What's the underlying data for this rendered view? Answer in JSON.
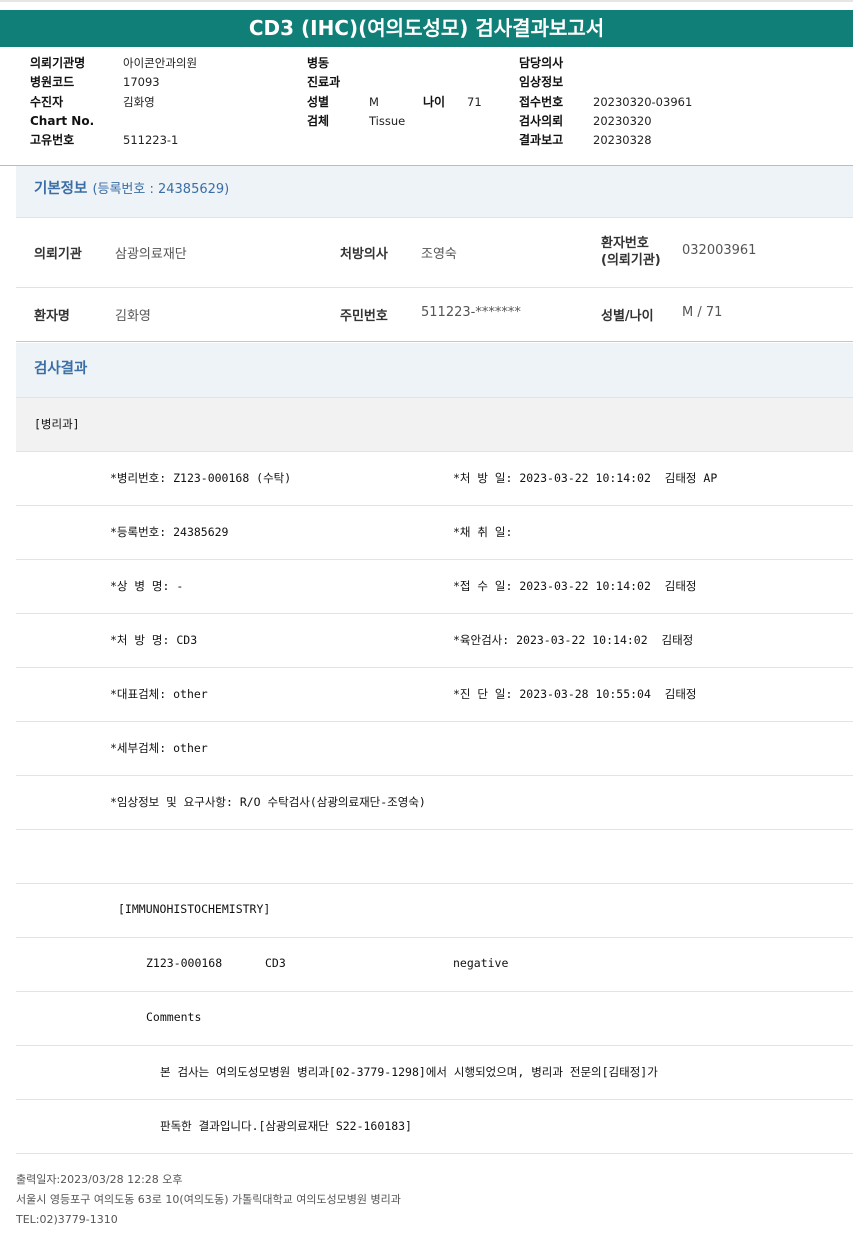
{
  "title": "CD3 (IHC)(여의도성모) 검사결과보고서",
  "header": {
    "col1": [
      {
        "label": "의뢰기관명",
        "value": "아이콘안과의원"
      },
      {
        "label": "병원코드",
        "value": "17093"
      },
      {
        "label": "수진자",
        "value": "김화영"
      },
      {
        "label": "Chart No.",
        "value": ""
      },
      {
        "label": "고유번호",
        "value": "511223-1"
      }
    ],
    "col2": [
      {
        "label": "병동",
        "value": ""
      },
      {
        "label": "진료과",
        "value": ""
      },
      {
        "label": "성별",
        "value": "M"
      },
      {
        "label": "검체",
        "value": "Tissue"
      }
    ],
    "age_label": "나이",
    "age_value": "71",
    "col3": [
      {
        "label": "담당의사",
        "value": ""
      },
      {
        "label": "임상정보",
        "value": ""
      },
      {
        "label": "접수번호",
        "value": "20230320-03961"
      },
      {
        "label": "검사의뢰",
        "value": "20230320"
      },
      {
        "label": "결과보고",
        "value": "20230328"
      }
    ]
  },
  "basic_info": {
    "heading": "기본정보",
    "reg_no": "(등록번호 : 24385629)",
    "row1": {
      "institution_label": "의뢰기관",
      "institution_value": "삼광의료재단",
      "doctor_label": "처방의사",
      "doctor_value": "조영숙",
      "patient_no_label_1": "환자번호",
      "patient_no_label_2": "(의뢰기관)",
      "patient_no_value": "032003961"
    },
    "row2": {
      "name_label": "환자명",
      "name_value": "김화영",
      "rrn_label": "주민번호",
      "rrn_value": "511223-*******",
      "sex_age_label": "성별/나이",
      "sex_age_value": "M / 71"
    }
  },
  "results": {
    "heading": "검사결과",
    "department": "[병리과]",
    "lines": [
      {
        "left": "*병리번호: Z123-000168 (수탁)",
        "right": "*처 방 일: 2023-03-22 10:14:02  김태정 AP"
      },
      {
        "left": "*등록번호: 24385629",
        "right": "*채 취 일:"
      },
      {
        "left": "*상 병 명: -",
        "right": "*접 수 일: 2023-03-22 10:14:02  김태정"
      },
      {
        "left": "*처 방 명: CD3",
        "right": "*육안검사: 2023-03-22 10:14:02  김태정"
      },
      {
        "left": "*대표검체: other",
        "right": "*진 단 일: 2023-03-28 10:55:04  김태정"
      },
      {
        "left": "*세부검체: other",
        "right": ""
      },
      {
        "left": "*임상정보 및 요구사항: R/O 수탁검사(삼광의료재단-조영숙)",
        "right": ""
      }
    ],
    "ihc_title": "[IMMUNOHISTOCHEMISTRY]",
    "ihc_row": {
      "id": "Z123-000168",
      "marker": "CD3",
      "result": "negative"
    },
    "comments_label": "Comments",
    "comment_line1": "본 검사는 여의도성모병원 병리과[02-3779-1298]에서 시행되었으며, 병리과 전문의[김태정]가",
    "comment_line2": "판독한 결과입니다.[삼광의료재단 S22-160183]"
  },
  "footer": {
    "print_date": "출력일자:2023/03/28 12:28 오후",
    "address": "서울시 영등포구 여의도동 63로 10(여의도동) 가톨릭대학교 여의도성모병원 병리과",
    "tel": "TEL:02)3779-1310"
  }
}
